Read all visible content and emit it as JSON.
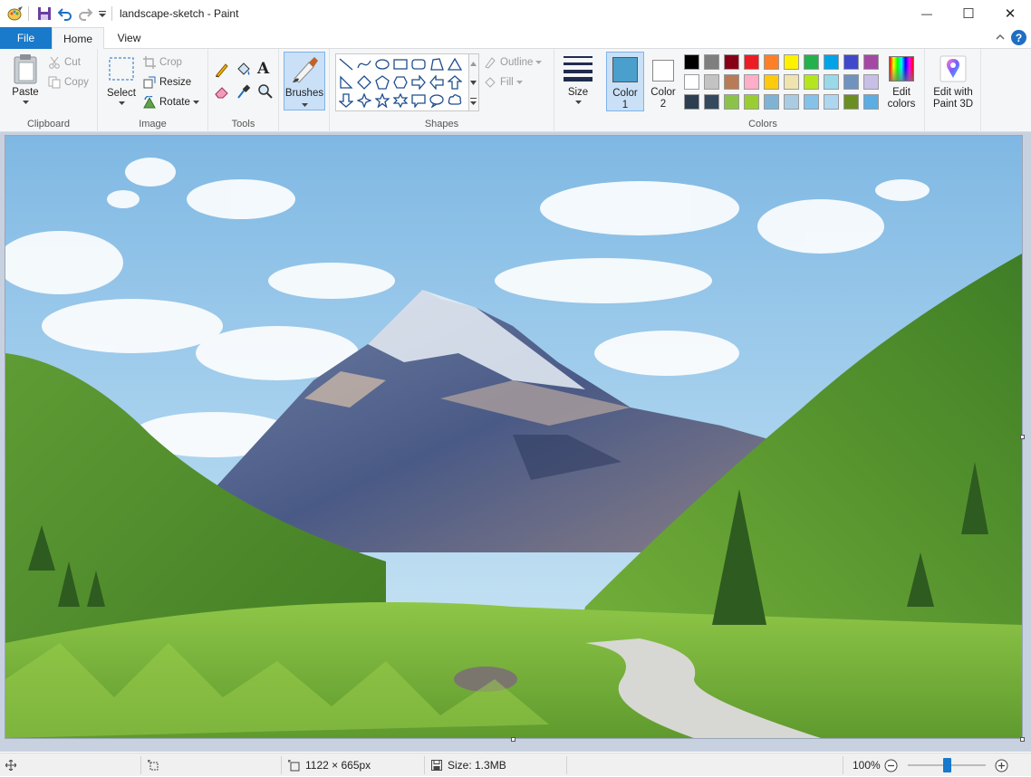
{
  "window": {
    "title": "landscape-sketch - Paint",
    "minimize_glyph": "—",
    "maximize_glyph": "☐",
    "close_glyph": "✕"
  },
  "tabs": {
    "file": "File",
    "home": "Home",
    "view": "View"
  },
  "clipboard": {
    "group_label": "Clipboard",
    "paste": "Paste",
    "cut": "Cut",
    "copy": "Copy"
  },
  "image": {
    "group_label": "Image",
    "select": "Select",
    "crop": "Crop",
    "resize": "Resize",
    "rotate": "Rotate"
  },
  "tools": {
    "group_label": "Tools",
    "items": [
      "pencil-icon",
      "fill-icon",
      "text-icon",
      "eraser-icon",
      "color-picker-icon",
      "magnifier-icon"
    ]
  },
  "brushes": {
    "label": "Brushes"
  },
  "shapes": {
    "group_label": "Shapes",
    "outline": "Outline",
    "fill": "Fill"
  },
  "size": {
    "label": "Size"
  },
  "colors": {
    "group_label": "Colors",
    "color1_label_line1": "Color",
    "color1_label_line2": "1",
    "color2_label_line1": "Color",
    "color2_label_line2": "2",
    "color1_value": "#4a9fcd",
    "color2_value": "#ffffff",
    "edit_colors_line1": "Edit",
    "edit_colors_line2": "colors",
    "palette": [
      "#000000",
      "#7f7f7f",
      "#880015",
      "#ed1c24",
      "#ff7f27",
      "#fff200",
      "#22b14c",
      "#00a2e8",
      "#3f48cc",
      "#a349a4",
      "#ffffff",
      "#c3c3c3",
      "#b97a57",
      "#ffaec9",
      "#ffc90e",
      "#efe4b0",
      "#b5e61d",
      "#99d9ea",
      "#7092be",
      "#c8bfe7",
      "#2c3e50",
      "#34495e",
      "#8bc34a",
      "#9acd32",
      "#7fb3d5",
      "#a9cce3",
      "#85c1e9",
      "#aed6f1",
      "#6b8e23",
      "#5dade2"
    ]
  },
  "paint3d": {
    "line1": "Edit with",
    "line2": "Paint 3D"
  },
  "status": {
    "dimensions": "1122 × 665px",
    "size": "Size: 1.3MB",
    "zoom": "100%",
    "zoom_level": 0.5
  }
}
